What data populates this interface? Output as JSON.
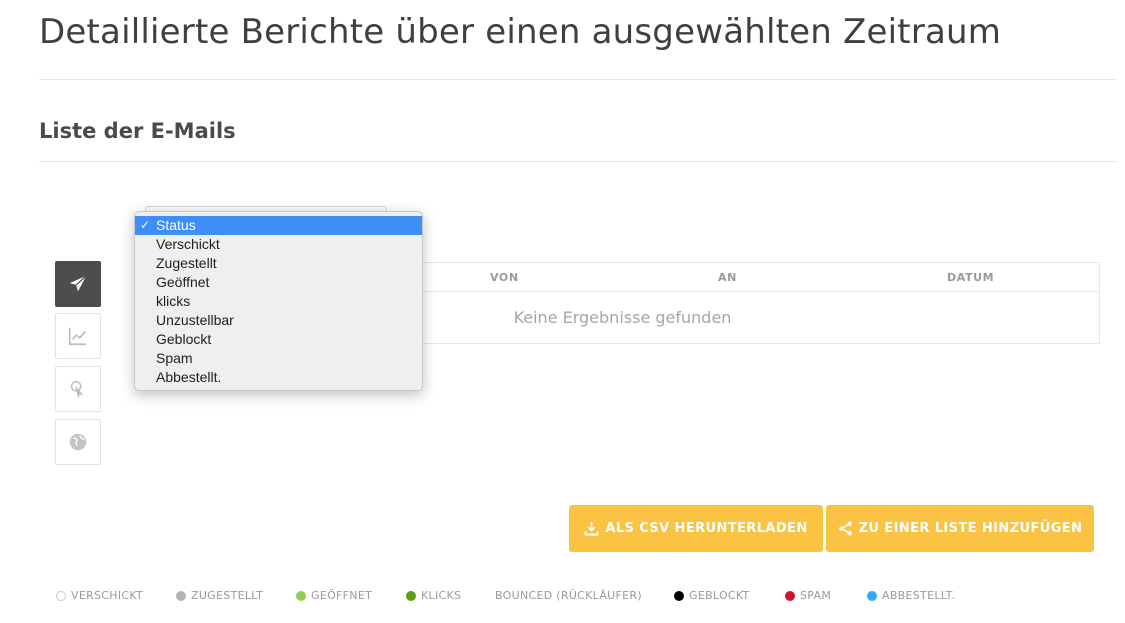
{
  "page": {
    "title": "Detaillierte Berichte über einen ausgewählten Zeitraum",
    "section_title": "Liste der E-Mails"
  },
  "side_tabs": [
    {
      "icon": "paper-plane-icon",
      "active": true
    },
    {
      "icon": "chart-line-icon",
      "active": false
    },
    {
      "icon": "pointer-click-icon",
      "active": false
    },
    {
      "icon": "globe-icon",
      "active": false
    }
  ],
  "status_dropdown": {
    "selected": "Status",
    "check_mark": "✓",
    "options": [
      "Status",
      "Verschickt",
      "Zugestellt",
      "Geöffnet",
      "klicks",
      "Unzustellbar",
      "Geblockt",
      "Spam",
      "Abbestellt."
    ]
  },
  "table": {
    "columns": [
      "VON",
      "AN",
      "DATUM"
    ],
    "empty_message": "Keine Ergebnisse gefunden"
  },
  "buttons": {
    "csv_label": "ALS CSV HERUNTERLADEN",
    "list_label": "ZU EINER LISTE HINZUFÜGEN",
    "color": "#fbc343"
  },
  "legend": [
    {
      "label": "VERSCHICKT",
      "color": "#ffffff",
      "outlined": true
    },
    {
      "label": "ZUGESTELLT",
      "color": "#b3b3b3"
    },
    {
      "label": "GEÖFFNET",
      "color": "#8fd14f"
    },
    {
      "label": "KLICKS",
      "color": "#5a9e1a"
    },
    {
      "label": "BOUNCED (RÜCKLÄUFER)",
      "color": null
    },
    {
      "label": "GEBLOCKT",
      "color": "#000000"
    },
    {
      "label": "SPAM",
      "color": "#d0122f"
    },
    {
      "label": "ABBESTELLT.",
      "color": "#33aaf3"
    }
  ]
}
